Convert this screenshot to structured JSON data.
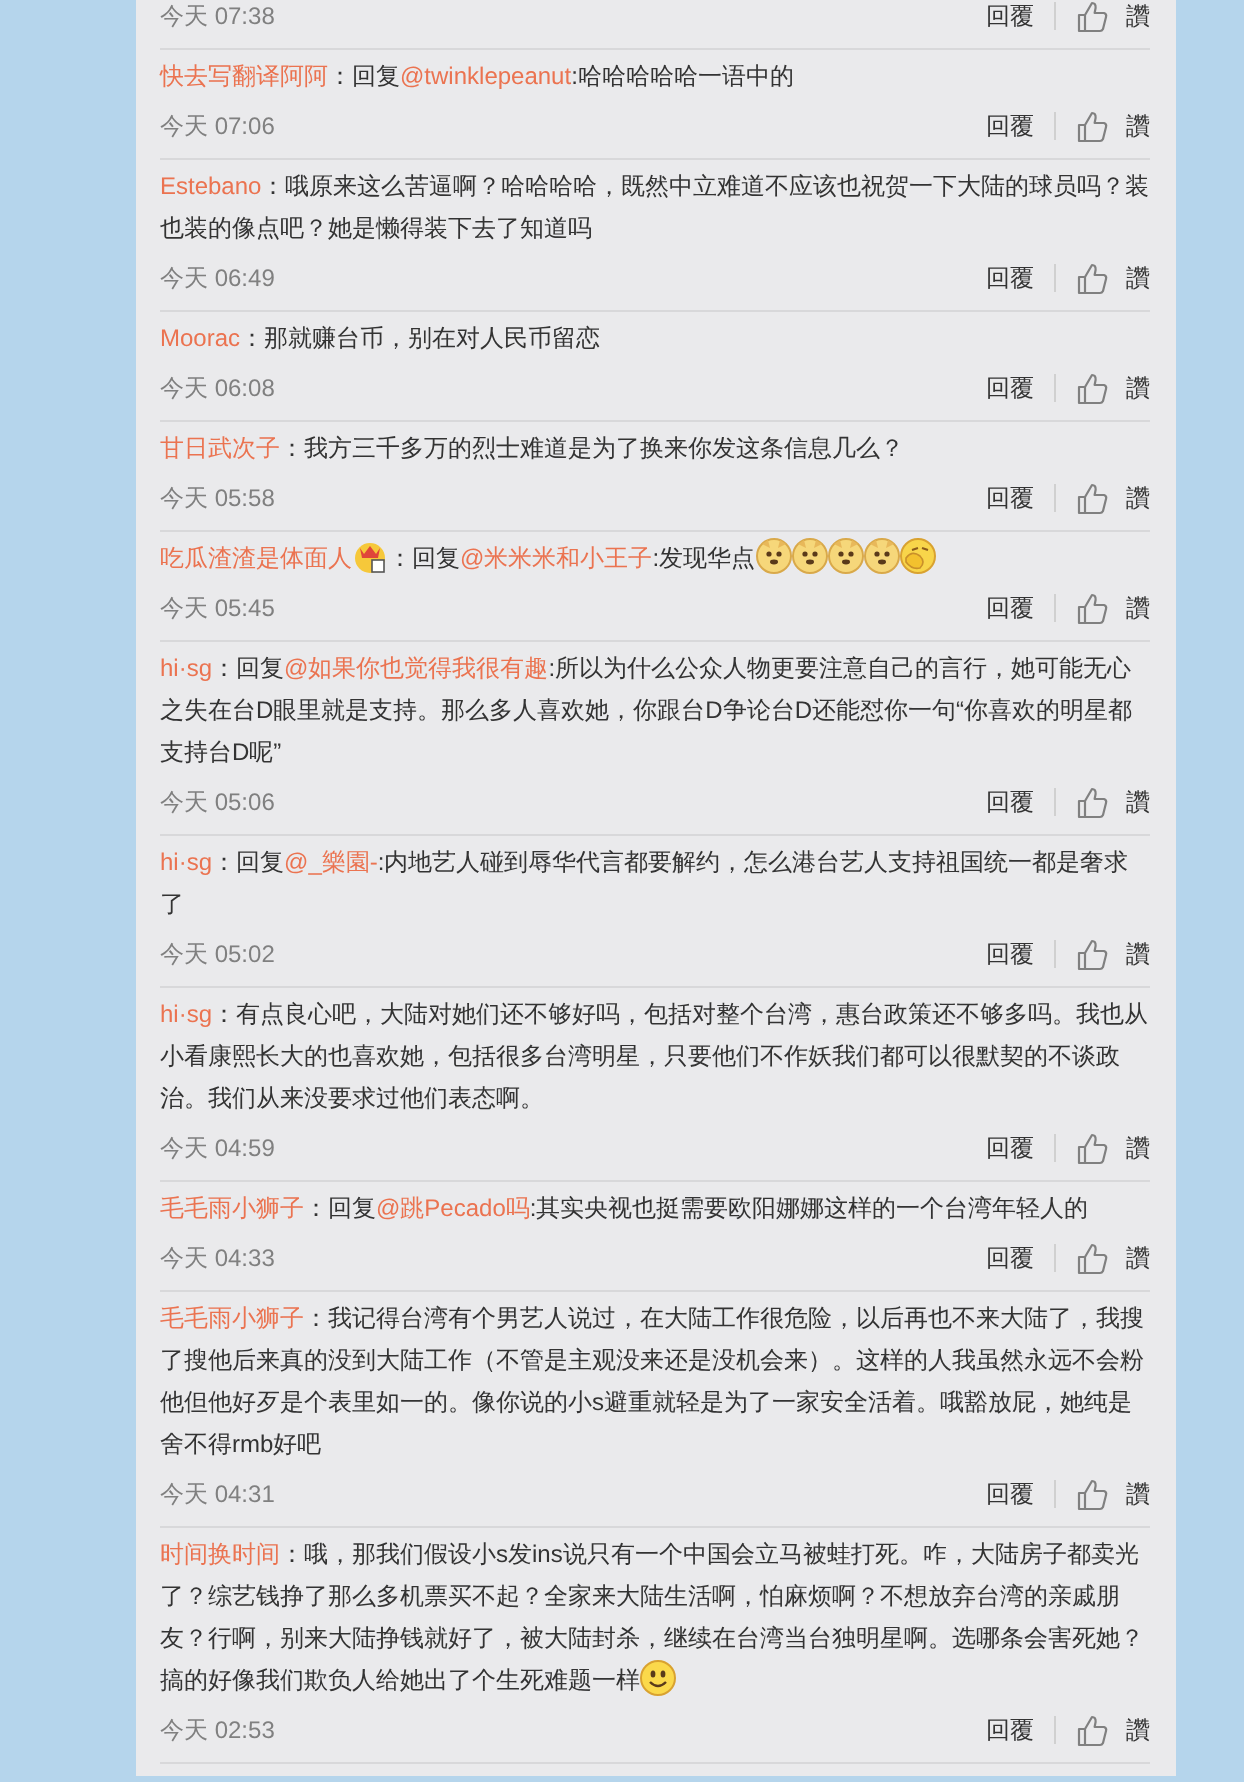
{
  "comments": [
    {
      "time": "今天 07:38",
      "reply_button": "回覆",
      "like_button": "讚"
    },
    {
      "user": "快去写翻译阿阿",
      "colon": "：",
      "reply_label": "回复",
      "mention": "@twinklepeanut",
      "text": ":哈哈哈哈哈一语中的",
      "time": "今天 07:06",
      "reply_button": "回覆",
      "like_button": "讚"
    },
    {
      "user": "Estebano",
      "colon": "：",
      "text": "哦原来这么苦逼啊？哈哈哈哈，既然中立难道不应该也祝贺一下大陆的球员吗？装也装的像点吧？她是懒得装下去了知道吗",
      "time": "今天 06:49",
      "reply_button": "回覆",
      "like_button": "讚"
    },
    {
      "user": "Moorac",
      "colon": "：",
      "text": "那就赚台币，别在对人民币留恋",
      "time": "今天 06:08",
      "reply_button": "回覆",
      "like_button": "讚"
    },
    {
      "user": "甘日武次子",
      "colon": "：",
      "text": "我方三千多万的烈士难道是为了换来你发这条信息几么？",
      "time": "今天 05:58",
      "reply_button": "回覆",
      "like_button": "讚"
    },
    {
      "user": "吃瓜渣渣是体面人",
      "badge": true,
      "colon": "：",
      "reply_label": "回复",
      "mention": "@米米米和小王子",
      "text": ":发现华点",
      "emoticons": [
        {
          "kind": "doge"
        },
        {
          "kind": "doge"
        },
        {
          "kind": "doge"
        },
        {
          "kind": "doge"
        },
        {
          "kind": "hide"
        }
      ],
      "time": "今天 05:45",
      "reply_button": "回覆",
      "like_button": "讚"
    },
    {
      "user": "hi·sg",
      "colon": "：",
      "reply_label": "回复",
      "mention": "@如果你也觉得我很有趣",
      "text": ":所以为什么公众人物更要注意自己的言行，她可能无心之失在台D眼里就是支持。那么多人喜欢她，你跟台D争论台D还能怼你一句“你喜欢的明星都支持台D呢”",
      "time": "今天 05:06",
      "reply_button": "回覆",
      "like_button": "讚"
    },
    {
      "user": "hi·sg",
      "colon": "：",
      "reply_label": "回复",
      "mention": "@_樂園-",
      "text": ":内地艺人碰到辱华代言都要解约，怎么港台艺人支持祖国统一都是奢求了",
      "time": "今天 05:02",
      "reply_button": "回覆",
      "like_button": "讚"
    },
    {
      "user": "hi·sg",
      "colon": "：",
      "text": "有点良心吧，大陆对她们还不够好吗，包括对整个台湾，惠台政策还不够多吗。我也从小看康熙长大的也喜欢她，包括很多台湾明星，只要他们不作妖我们都可以很默契的不谈政治。我们从来没要求过他们表态啊。",
      "time": "今天 04:59",
      "reply_button": "回覆",
      "like_button": "讚"
    },
    {
      "user": "毛毛雨小狮子",
      "colon": "：",
      "reply_label": "回复",
      "mention": "@跳Pecado吗",
      "text": ":其实央视也挺需要欧阳娜娜这样的一个台湾年轻人的",
      "time": "今天 04:33",
      "reply_button": "回覆",
      "like_button": "讚"
    },
    {
      "user": "毛毛雨小狮子",
      "colon": "：",
      "text": "我记得台湾有个男艺人说过，在大陆工作很危险，以后再也不来大陆了，我搜了搜他后来真的没到大陆工作（不管是主观没来还是没机会来）。这样的人我虽然永远不会粉他但他好歹是个表里如一的。像你说的小s避重就轻是为了一家安全活着。哦豁放屁，她纯是舍不得rmb好吧",
      "time": "今天 04:31",
      "reply_button": "回覆",
      "like_button": "讚"
    },
    {
      "user": "时间换时间",
      "colon": "：",
      "text": "哦，那我们假设小s发ins说只有一个中国会立马被蛙打死。咋，大陆房子都卖光了？综艺钱挣了那么多机票买不起？全家来大陆生活啊，怕麻烦啊？不想放弃台湾的亲戚朋友？行啊，别来大陆挣钱就好了，被大陆封杀，继续在台湾当台独明星啊。选哪条会害死她？搞的好像我们欺负人给她出了个生死难题一样",
      "emoticons": [
        {
          "kind": "smile"
        }
      ],
      "time": "今天 02:53",
      "reply_button": "回覆",
      "like_button": "讚"
    }
  ]
}
